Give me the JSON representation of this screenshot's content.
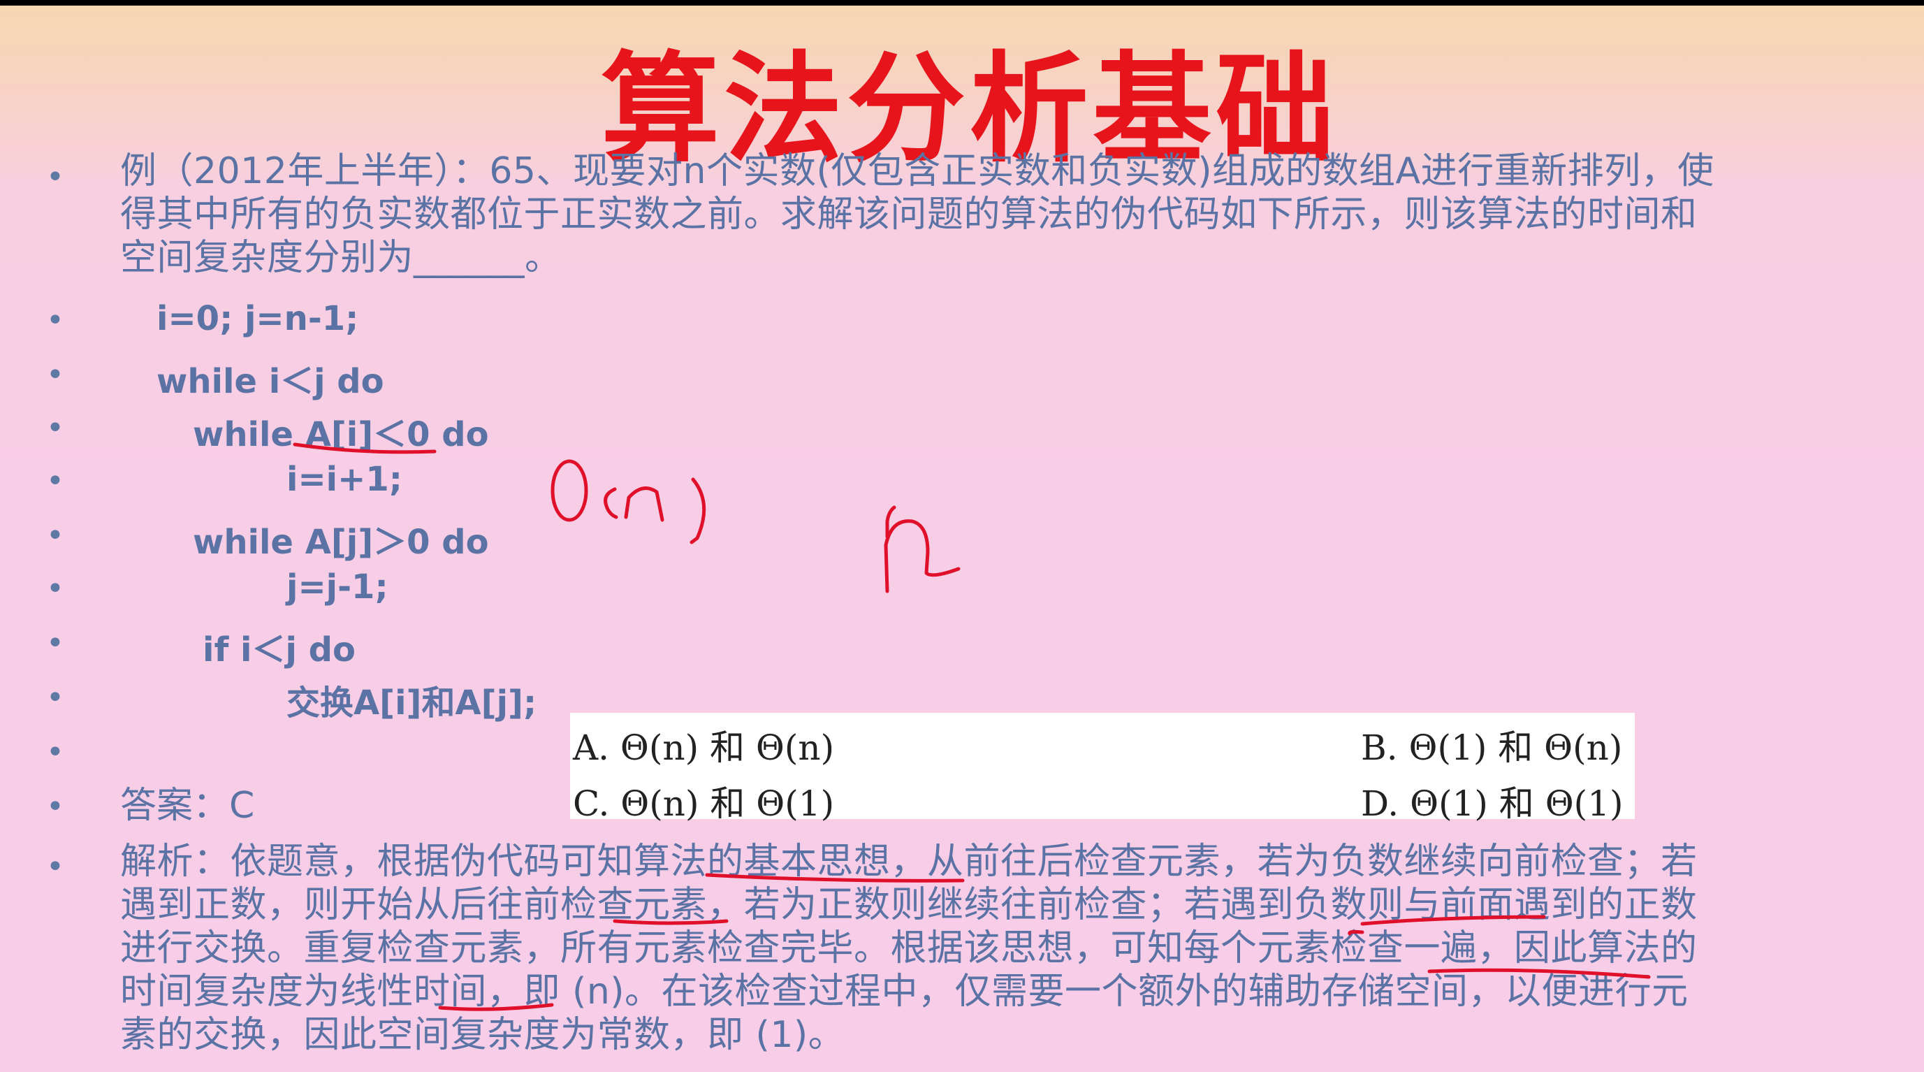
{
  "slide": {
    "title": "算法分析基础",
    "question": [
      "例（2012年上半年）：65、现要对n个实数(仅包含正实数和负实数)组成的数组A进行重新排列，使",
      "得其中所有的负实数都位于正实数之前。求解该问题的算法的伪代码如下所示，则该算法的时间和",
      "空间复杂度分别为______。"
    ],
    "code": [
      "i=0; j=n-1;",
      "while i＜j do",
      "while A[i]＜0 do",
      "i=i+1;",
      "while A[j]＞0 do",
      "j=j-1;",
      "if i＜j do",
      "交换A[i]和A[j];"
    ],
    "options": {
      "a": "A.   Θ(n) 和 Θ(n)",
      "b": "B.   Θ(1) 和 Θ(n)",
      "c": "C.   Θ(n) 和 Θ(1)",
      "d": "D.   Θ(1) 和 Θ(1)"
    },
    "answer": "答案：C",
    "analysis": [
      "解析：依题意，根据伪代码可知算法的基本思想，从前往后检查元素，若为负数继续向前检查；若",
      "遇到正数，则开始从后往前检查元素，若为正数则继续往前检查；若遇到负数则与前面遇到的正数",
      "进行交换。重复检查元素，所有元素检查完毕。根据该思想，可知每个元素检查一遍，因此算法的",
      "时间复杂度为线性时间，即 (n)。在该检查过程中，仅需要一个额外的辅助存储空间，以便进行元",
      "素的交换，因此空间复杂度为常数，即 (1)。"
    ]
  },
  "annotations": {
    "handwriting_1": "O(n)",
    "handwriting_2": "n",
    "ink_color": "#e0102a"
  }
}
